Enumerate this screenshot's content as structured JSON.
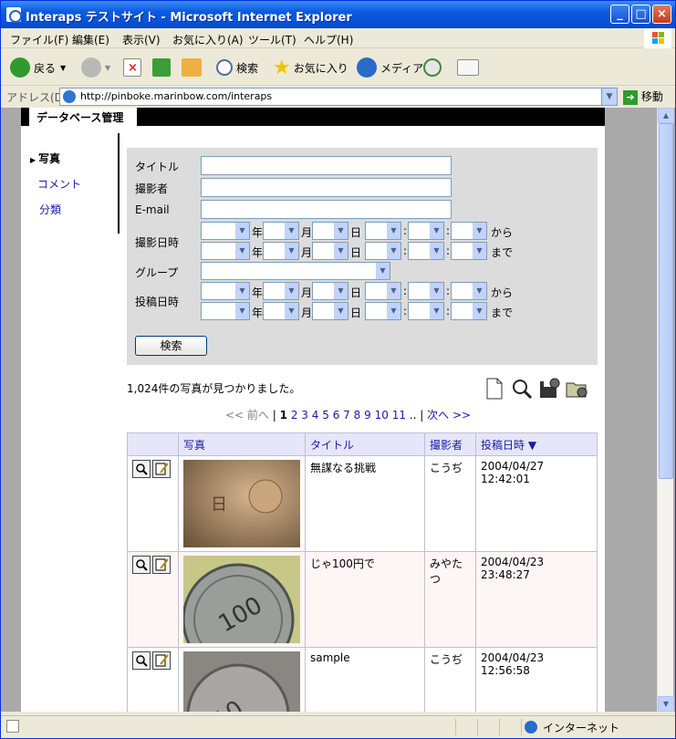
{
  "window": {
    "title": "Interaps テストサイト - Microsoft Internet Explorer"
  },
  "menu": [
    "ファイル(F)",
    "編集(E)",
    "表示(V)",
    "お気に入り(A)",
    "ツール(T)",
    "ヘルプ(H)"
  ],
  "toolbar": {
    "back": "戻る",
    "search": "検索",
    "favorites": "お気に入り",
    "media": "メディア"
  },
  "address": {
    "label": "アドレス(D)",
    "url": "http://pinboke.marinbow.com/interaps",
    "go": "移動"
  },
  "page": {
    "tab": "データベース管理",
    "nav": {
      "photo": "写真",
      "comment": "コメント",
      "category": "分類"
    },
    "form": {
      "title_label": "タイトル",
      "photographer_label": "撮影者",
      "email_label": "E-mail",
      "shot_date_label": "撮影日時",
      "group_label": "グループ",
      "post_date_label": "投稿日時",
      "year": "年",
      "month": "月",
      "day": "日",
      "colon": ":",
      "from": "から",
      "until": "まで",
      "search_button": "検索"
    },
    "found_text": "1,024件の写真が見つかりました。",
    "pager": {
      "first_prev": "<< 前へ",
      "sep": "|",
      "current": "1",
      "pages": [
        "2",
        "3",
        "4",
        "5",
        "6",
        "7",
        "8",
        "9",
        "10",
        "11"
      ],
      "ellipsis": "..",
      "next": "次へ >>"
    },
    "table": {
      "headers": [
        "写真",
        "タイトル",
        "撮影者",
        "投稿日時 ▼"
      ],
      "rows": [
        {
          "title": "無謀なる挑戦",
          "photographer": "こうぢ",
          "date": "2004/04/27",
          "time": "12:42:01"
        },
        {
          "title": "じゃ100円で",
          "photographer": "みやたつ",
          "date": "2004/04/23",
          "time": "23:48:27"
        },
        {
          "title": "sample",
          "photographer": "こうぢ",
          "date": "2004/04/23",
          "time": "12:56:58"
        }
      ]
    }
  },
  "status": {
    "zone": "インターネット"
  }
}
